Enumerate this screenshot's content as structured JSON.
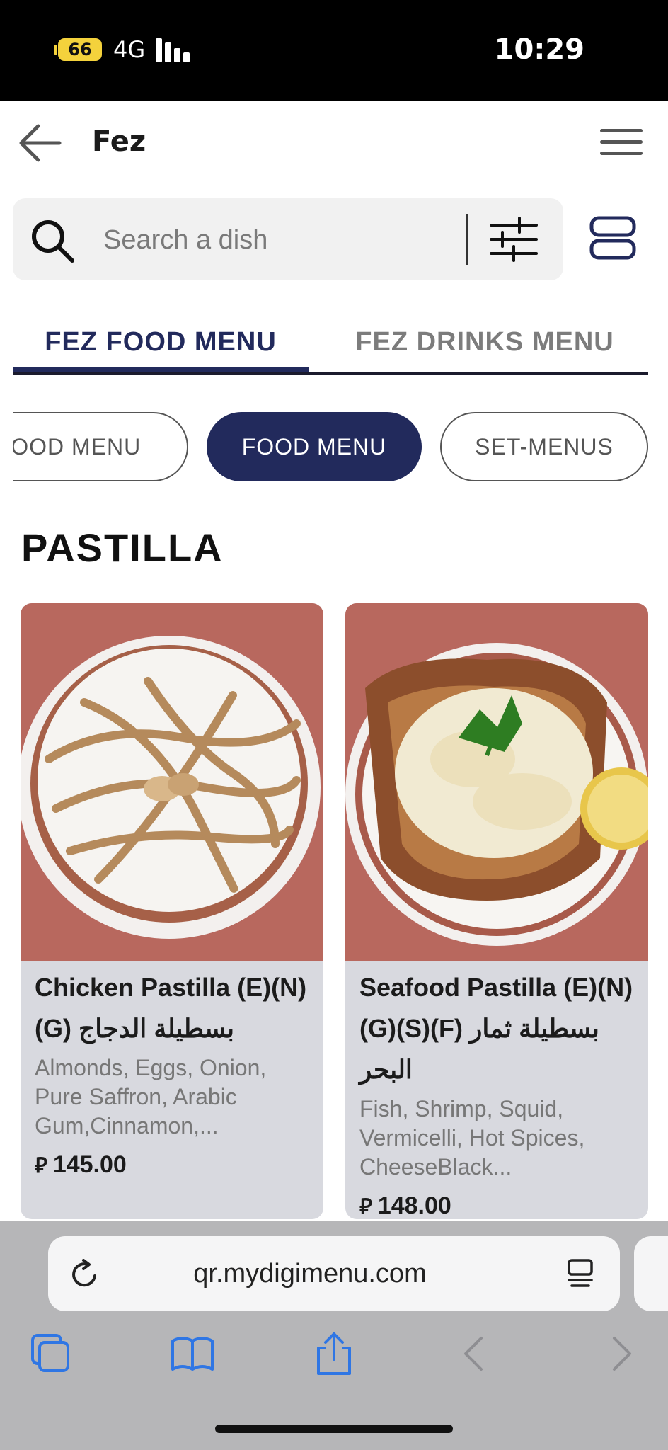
{
  "status_bar": {
    "battery": "66",
    "network": "4G",
    "time": "10:29"
  },
  "header": {
    "title": "Fez"
  },
  "search": {
    "placeholder": "Search a dish"
  },
  "menu_tabs": [
    {
      "label": "FEZ FOOD MENU",
      "active": true
    },
    {
      "label": "FEZ DRINKS MENU",
      "active": false
    }
  ],
  "category_pills": [
    {
      "label": "FOOD MENU",
      "active": false
    },
    {
      "label": "FOOD MENU",
      "active": true
    },
    {
      "label": "SET-MENUS",
      "active": false
    }
  ],
  "section": {
    "title": "PASTILLA"
  },
  "dishes": [
    {
      "name": "Chicken Pastilla (E)(N)(G) بسطيلة الدجاج",
      "description": "Almonds, Eggs, Onion, Pure Saffron, Arabic Gum,Cinnamon,...",
      "currency": "⃁",
      "price": "145.00"
    },
    {
      "name": "Seafood Pastilla (E)(N)(G)(S)(F) بسطيلة ثمار البحر",
      "description": "Fish, Shrimp, Squid, Vermicelli, Hot Spices, CheeseBlack...",
      "currency": "⃁",
      "price": "148.00"
    }
  ],
  "browser": {
    "url": "qr.mydigimenu.com"
  },
  "colors": {
    "accent": "#222a5c",
    "card_bg": "#d8d9df",
    "plate_rim": "#b8685e"
  },
  "icons": [
    "back-arrow-icon",
    "hamburger-menu-icon",
    "search-icon",
    "filter-sliders-icon",
    "layout-toggle-icon",
    "reload-icon",
    "reader-icon",
    "tabs-icon",
    "bookmarks-icon",
    "share-icon",
    "back-icon",
    "forward-icon"
  ]
}
